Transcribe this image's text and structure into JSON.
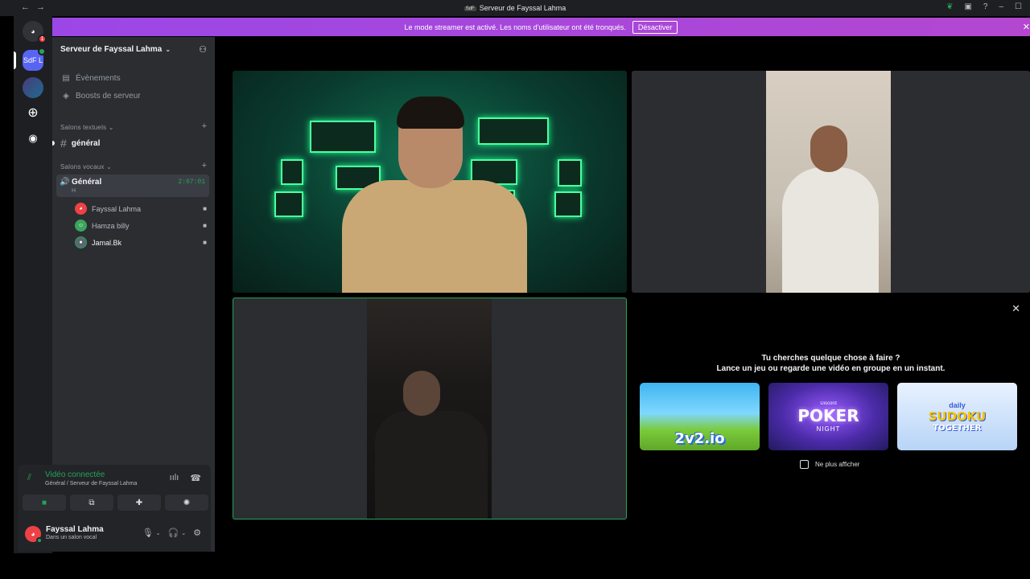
{
  "window": {
    "title": "Serveur de Fayssal Lahma",
    "title_badge": "SdF"
  },
  "streamer_banner": {
    "text": "Le mode streamer est activé. Les noms d'utilisateur ont été tronqués.",
    "button": "Désactiver"
  },
  "guilds": {
    "home_badge": "1",
    "server_abbrev": "SdF L"
  },
  "sidebar": {
    "server_name": "Serveur de Fayssal Lahma",
    "events": "Évènements",
    "boosts": "Boosts de serveur",
    "text_category": "Salons textuels",
    "text_channel": "général",
    "voice_category": "Salons vocaux",
    "voice_channel": "Général",
    "voice_channel_sub": "H",
    "voice_timer": "2:07:01",
    "members": [
      {
        "name": "Fayssal Lahma",
        "color": "#ed4245"
      },
      {
        "name": "Hamza billy",
        "color": "#3ba55c"
      },
      {
        "name": "Jamal.Bk",
        "color": "#5b6770"
      }
    ]
  },
  "voice_panel": {
    "status": "Vidéo connectée",
    "location": "Général / Serveur de Fayssal Lahma"
  },
  "user_panel": {
    "name": "Fayssal Lahma",
    "status": "Dans un salon vocal"
  },
  "activity": {
    "title": "Tu cherches quelque chose à faire ?",
    "subtitle": "Lance un jeu ou regarde une vidéo en groupe en un instant.",
    "games": [
      {
        "name": "2v2.io"
      },
      {
        "brand": "Discord",
        "name": "POKER",
        "tag": "NIGHT"
      },
      {
        "pre": "daily",
        "name": "SUDOKU",
        "tag": "TOGETHER"
      }
    ],
    "dont_show": "Ne plus afficher"
  }
}
